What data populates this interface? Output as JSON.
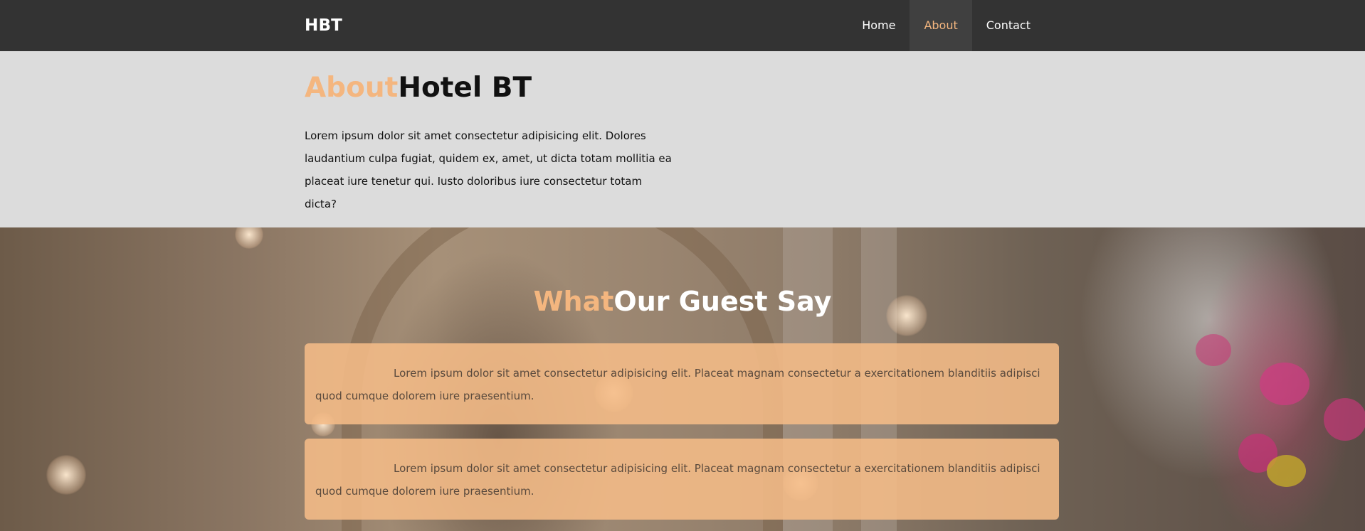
{
  "navbar": {
    "brand": "HBT",
    "items": [
      {
        "label": "Home",
        "active": false
      },
      {
        "label": "About",
        "active": true
      },
      {
        "label": "Contact",
        "active": false
      }
    ]
  },
  "about": {
    "title_accent": "About",
    "title_rest": "Hotel BT",
    "text": "Lorem ipsum dolor sit amet consectetur adipisicing elit. Dolores laudantium culpa fugiat, quidem ex, amet, ut dicta totam mollitia ea placeat iure tenetur qui. Iusto doloribus iure consectetur totam dicta?"
  },
  "testimonials": {
    "title_accent": "What",
    "title_rest": "Our Guest Say",
    "cards": [
      {
        "text": "Lorem ipsum dolor sit amet consectetur adipisicing elit. Placeat magnam consectetur a exercitationem blanditiis adipisci quod cumque dolorem iure praesentium."
      },
      {
        "text": "Lorem ipsum dolor sit amet consectetur adipisicing elit. Placeat magnam consectetur a exercitationem blanditiis adipisci quod cumque dolorem iure praesentium."
      }
    ]
  },
  "colors": {
    "navbar_bg": "#333333",
    "accent": "#f4b67f",
    "about_bg": "#dcdcdc",
    "card_bg": "#f5bc87"
  }
}
